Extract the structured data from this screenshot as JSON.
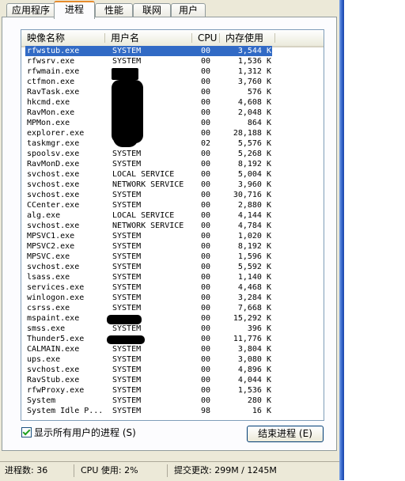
{
  "tabs": [
    {
      "label": "应用程序",
      "active": false
    },
    {
      "label": "进程",
      "active": true
    },
    {
      "label": "性能",
      "active": false
    },
    {
      "label": "联网",
      "active": false
    },
    {
      "label": "用户",
      "active": false
    }
  ],
  "columns": {
    "name": "映像名称",
    "user": "用户名",
    "cpu": "CPU",
    "mem": "内存使用"
  },
  "processes": [
    {
      "name": "rfwstub.exe",
      "user": "SYSTEM",
      "cpu": "00",
      "mem": "3,544 K",
      "selected": true
    },
    {
      "name": "rfwsrv.exe",
      "user": "SYSTEM",
      "cpu": "00",
      "mem": "1,536 K"
    },
    {
      "name": "rfwmain.exe",
      "user": "",
      "cpu": "00",
      "mem": "1,312 K"
    },
    {
      "name": "ctfmon.exe",
      "user": "",
      "cpu": "00",
      "mem": "3,760 K"
    },
    {
      "name": "RavTask.exe",
      "user": "",
      "cpu": "00",
      "mem": "576 K"
    },
    {
      "name": "hkcmd.exe",
      "user": "",
      "cpu": "00",
      "mem": "4,608 K"
    },
    {
      "name": "RavMon.exe",
      "user": "",
      "cpu": "00",
      "mem": "2,048 K"
    },
    {
      "name": "MPMon.exe",
      "user": "",
      "cpu": "00",
      "mem": "864 K"
    },
    {
      "name": "explorer.exe",
      "user": "",
      "cpu": "00",
      "mem": "28,188 K"
    },
    {
      "name": "taskmgr.exe",
      "user": "",
      "cpu": "02",
      "mem": "5,576 K"
    },
    {
      "name": "spoolsv.exe",
      "user": "SYSTEM",
      "cpu": "00",
      "mem": "5,268 K"
    },
    {
      "name": "RavMonD.exe",
      "user": "SYSTEM",
      "cpu": "00",
      "mem": "8,192 K"
    },
    {
      "name": "svchost.exe",
      "user": "LOCAL SERVICE",
      "cpu": "00",
      "mem": "5,004 K"
    },
    {
      "name": "svchost.exe",
      "user": "NETWORK SERVICE",
      "cpu": "00",
      "mem": "3,960 K"
    },
    {
      "name": "svchost.exe",
      "user": "SYSTEM",
      "cpu": "00",
      "mem": "30,716 K"
    },
    {
      "name": "CCenter.exe",
      "user": "SYSTEM",
      "cpu": "00",
      "mem": "2,880 K"
    },
    {
      "name": "alg.exe",
      "user": "LOCAL SERVICE",
      "cpu": "00",
      "mem": "4,144 K"
    },
    {
      "name": "svchost.exe",
      "user": "NETWORK SERVICE",
      "cpu": "00",
      "mem": "4,784 K"
    },
    {
      "name": "MPSVC1.exe",
      "user": "SYSTEM",
      "cpu": "00",
      "mem": "1,020 K"
    },
    {
      "name": "MPSVC2.exe",
      "user": "SYSTEM",
      "cpu": "00",
      "mem": "8,192 K"
    },
    {
      "name": "MPSVC.exe",
      "user": "SYSTEM",
      "cpu": "00",
      "mem": "1,596 K"
    },
    {
      "name": "svchost.exe",
      "user": "SYSTEM",
      "cpu": "00",
      "mem": "5,592 K"
    },
    {
      "name": "lsass.exe",
      "user": "SYSTEM",
      "cpu": "00",
      "mem": "1,140 K"
    },
    {
      "name": "services.exe",
      "user": "SYSTEM",
      "cpu": "00",
      "mem": "4,468 K"
    },
    {
      "name": "winlogon.exe",
      "user": "SYSTEM",
      "cpu": "00",
      "mem": "3,284 K"
    },
    {
      "name": "csrss.exe",
      "user": "SYSTEM",
      "cpu": "00",
      "mem": "7,668 K"
    },
    {
      "name": "mspaint.exe",
      "user": "",
      "cpu": "00",
      "mem": "15,292 K"
    },
    {
      "name": "smss.exe",
      "user": "SYSTEM",
      "cpu": "00",
      "mem": "396 K"
    },
    {
      "name": "Thunder5.exe",
      "user": "",
      "cpu": "00",
      "mem": "11,776 K"
    },
    {
      "name": "CALMAIN.exe",
      "user": "SYSTEM",
      "cpu": "00",
      "mem": "3,804 K"
    },
    {
      "name": "ups.exe",
      "user": "SYSTEM",
      "cpu": "00",
      "mem": "3,080 K"
    },
    {
      "name": "svchost.exe",
      "user": "SYSTEM",
      "cpu": "00",
      "mem": "4,896 K"
    },
    {
      "name": "RavStub.exe",
      "user": "SYSTEM",
      "cpu": "00",
      "mem": "4,044 K"
    },
    {
      "name": "rfwProxy.exe",
      "user": "SYSTEM",
      "cpu": "00",
      "mem": "1,536 K"
    },
    {
      "name": "System",
      "user": "SYSTEM",
      "cpu": "00",
      "mem": "280 K"
    },
    {
      "name": "System Idle P...",
      "user": "SYSTEM",
      "cpu": "98",
      "mem": "16 K"
    }
  ],
  "show_all_users": {
    "label": "显示所有用户的进程 (S)",
    "checked": true
  },
  "end_process_button": "结束进程 (E)",
  "statusbar": {
    "processes": "进程数: 36",
    "cpu": "CPU 使用: 2%",
    "commit": "提交更改: 299M / 1245M"
  }
}
